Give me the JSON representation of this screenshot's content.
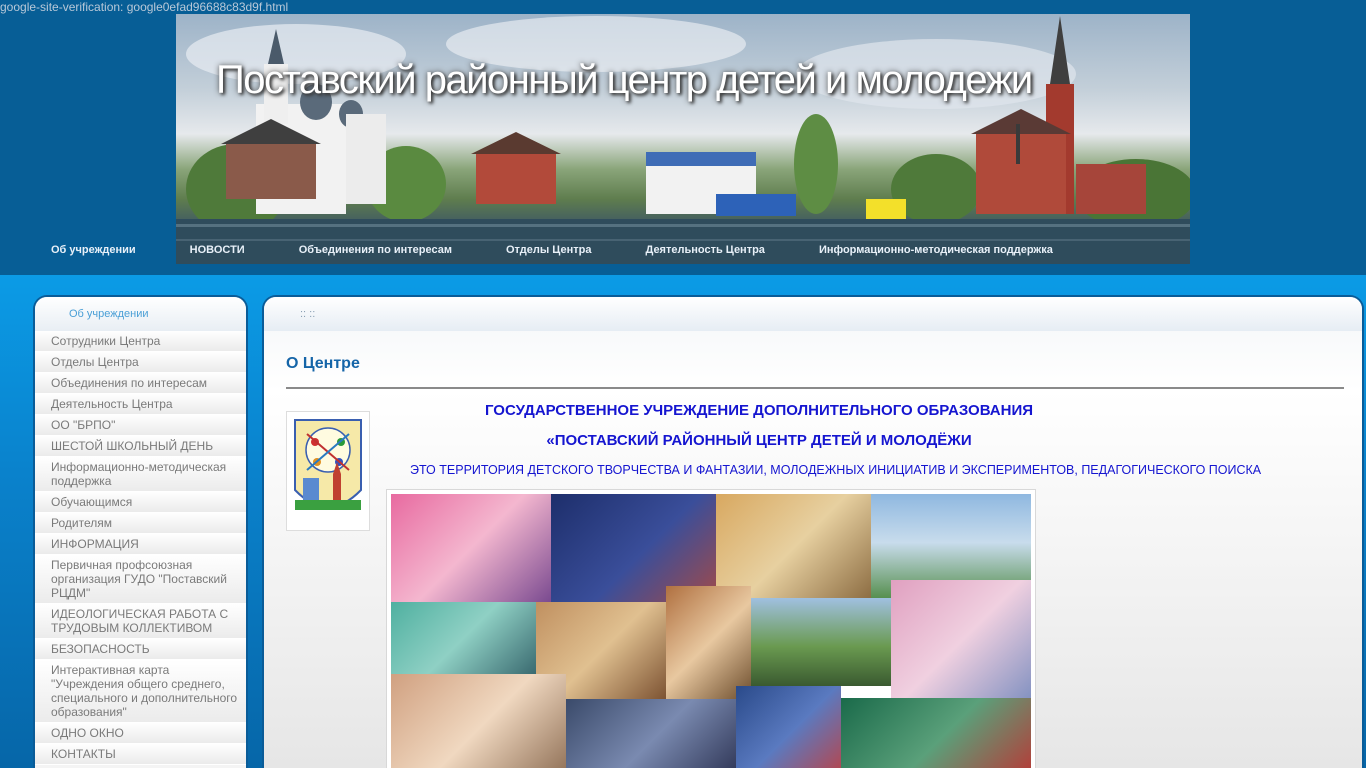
{
  "verification_text": "google-site-verification: google0efad96688c83d9f.html",
  "site_title": "Поставский районный центр детей и молодежи",
  "top_nav": [
    "Об учреждении",
    "НОВОСТИ",
    "Объединения по интересам",
    "Отделы Центра",
    "Деятельность Центра",
    "Информационно-методическая поддержка"
  ],
  "sidebar": {
    "heading": "Об учреждении",
    "items": [
      "Сотрудники Центра",
      "Отделы Центра",
      "Объединения по интересам",
      "Деятельность Центра",
      "ОО \"БРПО\"",
      "ШЕСТОЙ ШКОЛЬНЫЙ ДЕНЬ",
      "Информационно-методическая поддержка",
      "Обучающимся",
      "Родителям",
      "ИНФОРМАЦИЯ",
      "Первичная профсоюзная организация ГУДО \"Поставский РЦДМ\"",
      "ИДЕОЛОГИЧЕСКАЯ РАБОТА С ТРУДОВЫМ КОЛЛЕКТИВОМ",
      "БЕЗОПАСНОСТЬ",
      "Интерактивная карта \"Учреждения общего среднего, специального и дополнительного образования\"",
      "ОДНО ОКНО",
      "КОНТАКТЫ"
    ]
  },
  "breadcrumb": ":: ::",
  "page_title": "О Центре",
  "org_line_1": "ГОСУДАРСТВЕННОЕ УЧРЕЖДЕНИЕ ДОПОЛНИТЕЛЬНОГО  ОБРАЗОВАНИЯ",
  "org_line_2": "«ПОСТАВСКИЙ РАЙОННЫЙ ЦЕНТР   ДЕТЕЙ И МОЛОДЁЖИ",
  "tagline": "ЭТО ТЕРРИТОРИЯ ДЕТСКОГО ТВОРЧЕСТВА И ФАНТАЗИИ, МОЛОДЕЖНЫХ ИНИЦИАТИВ И ЭКСПЕРИМЕНТОВ, ПЕДАГОГИЧЕСКОГО ПОИСКА",
  "logo_letters": "Р Ц Д М",
  "colors": {
    "background": "#0868a4",
    "accent_blue": "#1565a8",
    "org_text": "#1515d0",
    "sidebar_text": "#7a7a7a"
  }
}
